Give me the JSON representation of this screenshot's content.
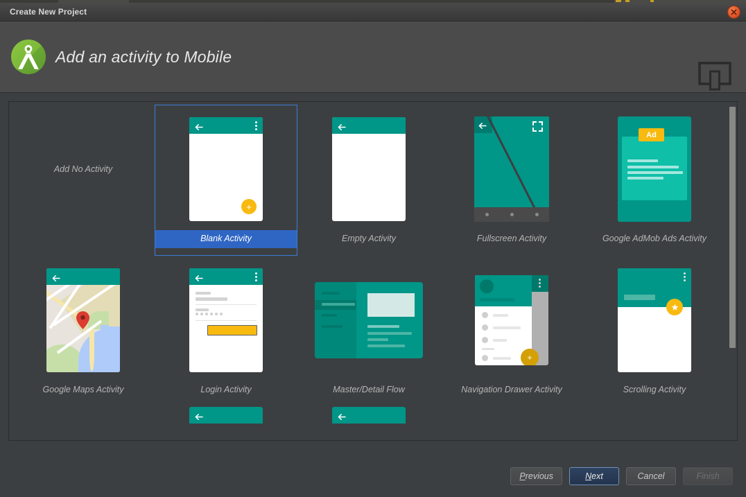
{
  "window": {
    "title": "Create New Project",
    "close_icon": "close-icon"
  },
  "header": {
    "title": "Add an activity to Mobile",
    "logo_icon": "android-studio-logo",
    "device_icon": "tablet-and-phone-icon"
  },
  "colors": {
    "teal": "#009688",
    "teal_dark": "#00796b",
    "teal_light": "#0fbfa8",
    "amber": "#f9ba10",
    "selection_blue": "#2f66c4",
    "selection_border": "#3b7dd8",
    "dialog_bg": "#3c3f41",
    "header_bg": "#4b4b4b"
  },
  "gallery": {
    "selected": "Blank Activity",
    "rows": [
      [
        {
          "label": "Add No Activity",
          "art": "none",
          "selected": false
        },
        {
          "label": "Blank Activity",
          "art": "blank",
          "selected": true
        },
        {
          "label": "Empty Activity",
          "art": "empty",
          "selected": false
        },
        {
          "label": "Fullscreen Activity",
          "art": "fullscreen",
          "selected": false
        },
        {
          "label": "Google AdMob Ads Activity",
          "art": "admob",
          "selected": false
        }
      ],
      [
        {
          "label": "Google Maps Activity",
          "art": "maps",
          "selected": false
        },
        {
          "label": "Login Activity",
          "art": "login",
          "selected": false
        },
        {
          "label": "Master/Detail Flow",
          "art": "masterdetail",
          "selected": false
        },
        {
          "label": "Navigation Drawer Activity",
          "art": "navdrawer",
          "selected": false
        },
        {
          "label": "Scrolling Activity",
          "art": "scrolling",
          "selected": false
        }
      ]
    ],
    "clipped_row_count": 2,
    "admob_badge": "Ad",
    "scrollbar": {
      "name": "vertical-scrollbar"
    }
  },
  "footer": {
    "previous": {
      "label": "Previous",
      "mnemonic": "P",
      "state": "enabled"
    },
    "next": {
      "label": "Next",
      "mnemonic": "N",
      "state": "default"
    },
    "cancel": {
      "label": "Cancel",
      "state": "enabled"
    },
    "finish": {
      "label": "Finish",
      "state": "disabled"
    }
  }
}
